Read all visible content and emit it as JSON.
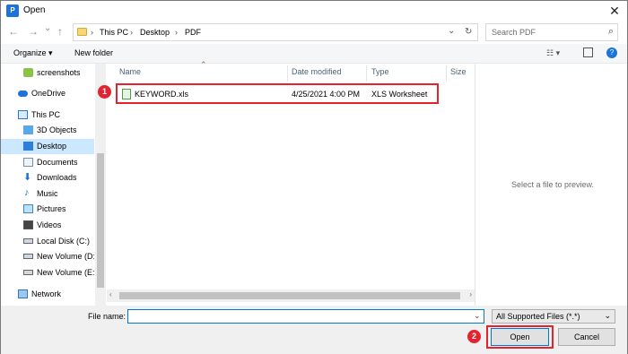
{
  "window": {
    "title": "Open",
    "close_glyph": "✕"
  },
  "nav": {
    "back": "←",
    "forward": "→",
    "dropdown": "⌄",
    "up": "↑",
    "breadcrumbs": [
      "This PC",
      "Desktop",
      "PDF"
    ],
    "search_placeholder": "Search PDF"
  },
  "toolbar": {
    "organize": "Organize ▾",
    "new_folder": "New folder"
  },
  "sidebar": {
    "items": [
      {
        "label": "screenshots",
        "icon": "screenshots-folder-icon"
      },
      {
        "label": "OneDrive",
        "icon": "cloud-icon"
      },
      {
        "label": "This PC",
        "icon": "computer-icon"
      },
      {
        "label": "3D Objects",
        "icon": "cube-icon"
      },
      {
        "label": "Desktop",
        "icon": "desktop-icon",
        "selected": true
      },
      {
        "label": "Documents",
        "icon": "documents-icon"
      },
      {
        "label": "Downloads",
        "icon": "download-icon"
      },
      {
        "label": "Music",
        "icon": "music-icon"
      },
      {
        "label": "Pictures",
        "icon": "pictures-icon"
      },
      {
        "label": "Videos",
        "icon": "videos-icon"
      },
      {
        "label": "Local Disk (C:)",
        "icon": "drive-icon"
      },
      {
        "label": "New Volume (D:",
        "icon": "drive-icon"
      },
      {
        "label": "New Volume (E:)",
        "icon": "drive-icon"
      },
      {
        "label": "Network",
        "icon": "network-icon"
      }
    ]
  },
  "columns": {
    "name": "Name",
    "date": "Date modified",
    "type": "Type",
    "size": "Size"
  },
  "files": [
    {
      "name": "KEYWORD.xls",
      "date": "4/25/2021 4:00 PM",
      "type": "XLS Worksheet",
      "size": ""
    }
  ],
  "preview": {
    "text": "Select a file to preview."
  },
  "bottom": {
    "filename_label": "File name:",
    "filename_value": "",
    "filetype": "All Supported Files (*.*)",
    "open_label": "Open",
    "cancel_label": "Cancel"
  },
  "annotations": {
    "badge1": "1",
    "badge2": "2"
  },
  "colors": {
    "highlight": "#e5232f",
    "accent": "#0078d7",
    "selected_bg": "#cce8ff"
  }
}
